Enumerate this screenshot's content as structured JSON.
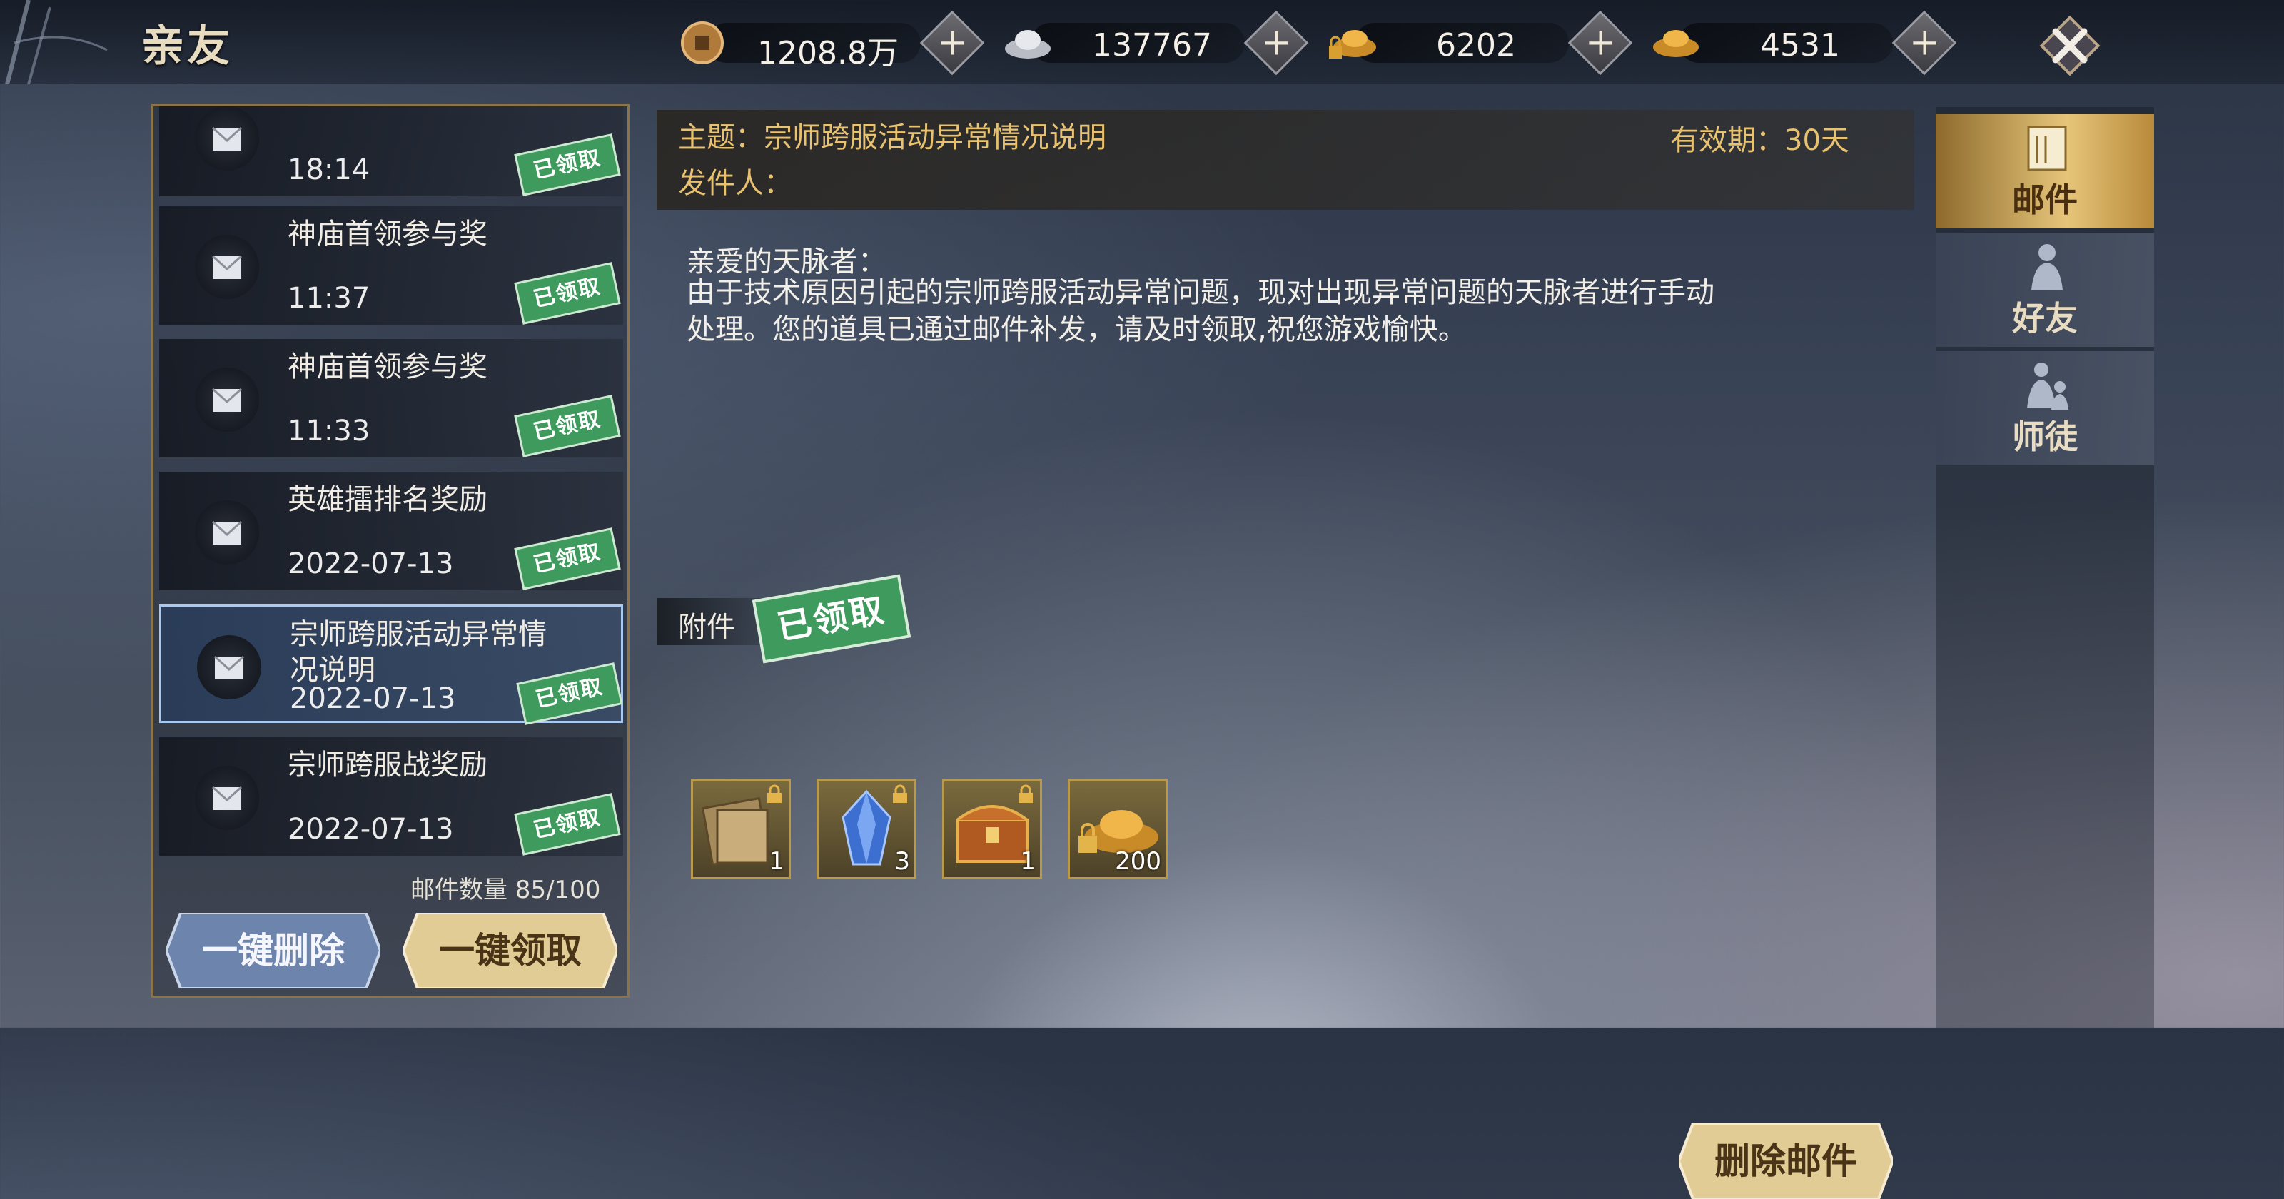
{
  "header": {
    "title": "亲友",
    "currencies": [
      {
        "icon": "copper-coin-icon",
        "value": "1208.8万"
      },
      {
        "icon": "silver-ingot-icon",
        "value": "137767"
      },
      {
        "icon": "locked-gold-ingot-icon",
        "value": "6202"
      },
      {
        "icon": "gold-ingot-icon",
        "value": "4531"
      }
    ],
    "plus_label": "+"
  },
  "mail_list": {
    "items": [
      {
        "title": "",
        "time": "18:14",
        "stamp": "已领取"
      },
      {
        "title": "神庙首领参与奖",
        "time": "11:37",
        "stamp": "已领取"
      },
      {
        "title": "神庙首领参与奖",
        "time": "11:33",
        "stamp": "已领取"
      },
      {
        "title": "英雄擂排名奖励",
        "time": "2022-07-13",
        "stamp": "已领取"
      },
      {
        "title": "宗师跨服活动异常情况说明",
        "time": "2022-07-13",
        "stamp": "已领取",
        "selected": true
      },
      {
        "title": "宗师跨服战奖励",
        "time": "2022-07-13",
        "stamp": "已领取"
      }
    ],
    "count_label": "邮件数量 85/100",
    "delete_all_label": "一键删除",
    "claim_all_label": "一键领取"
  },
  "mail": {
    "subject": "主题：宗师跨服活动异常情况说明",
    "sender": "发件人：",
    "validity": "有效期：30天",
    "greeting": "亲爱的天脉者：",
    "content": "由于技术原因引起的宗师跨服活动异常问题，现对出现异常问题的天脉者进行手动处理。您的道具已通过邮件补发，请及时领取,祝您游戏愉快。",
    "attachment_label": "附件",
    "attachment_stamp": "已领取",
    "attachments": [
      {
        "icon": "book-scroll-icon",
        "qty": "1"
      },
      {
        "icon": "blue-crystal-icon",
        "qty": "3"
      },
      {
        "icon": "treasure-chest-icon",
        "qty": "1"
      },
      {
        "icon": "gold-ingot-icon",
        "qty": "200"
      }
    ],
    "delete_label": "删除邮件"
  },
  "tabs": [
    {
      "label": "邮件",
      "icon": "mail-scroll-icon",
      "active": true
    },
    {
      "label": "好友",
      "icon": "friend-figure-icon",
      "active": false
    },
    {
      "label": "师徒",
      "icon": "master-apprentice-icon",
      "active": false
    }
  ],
  "colors": {
    "accent_gold": "#e8c270",
    "stamp_green": "#3f9a5e",
    "selected_border": "#a9c9f2"
  }
}
